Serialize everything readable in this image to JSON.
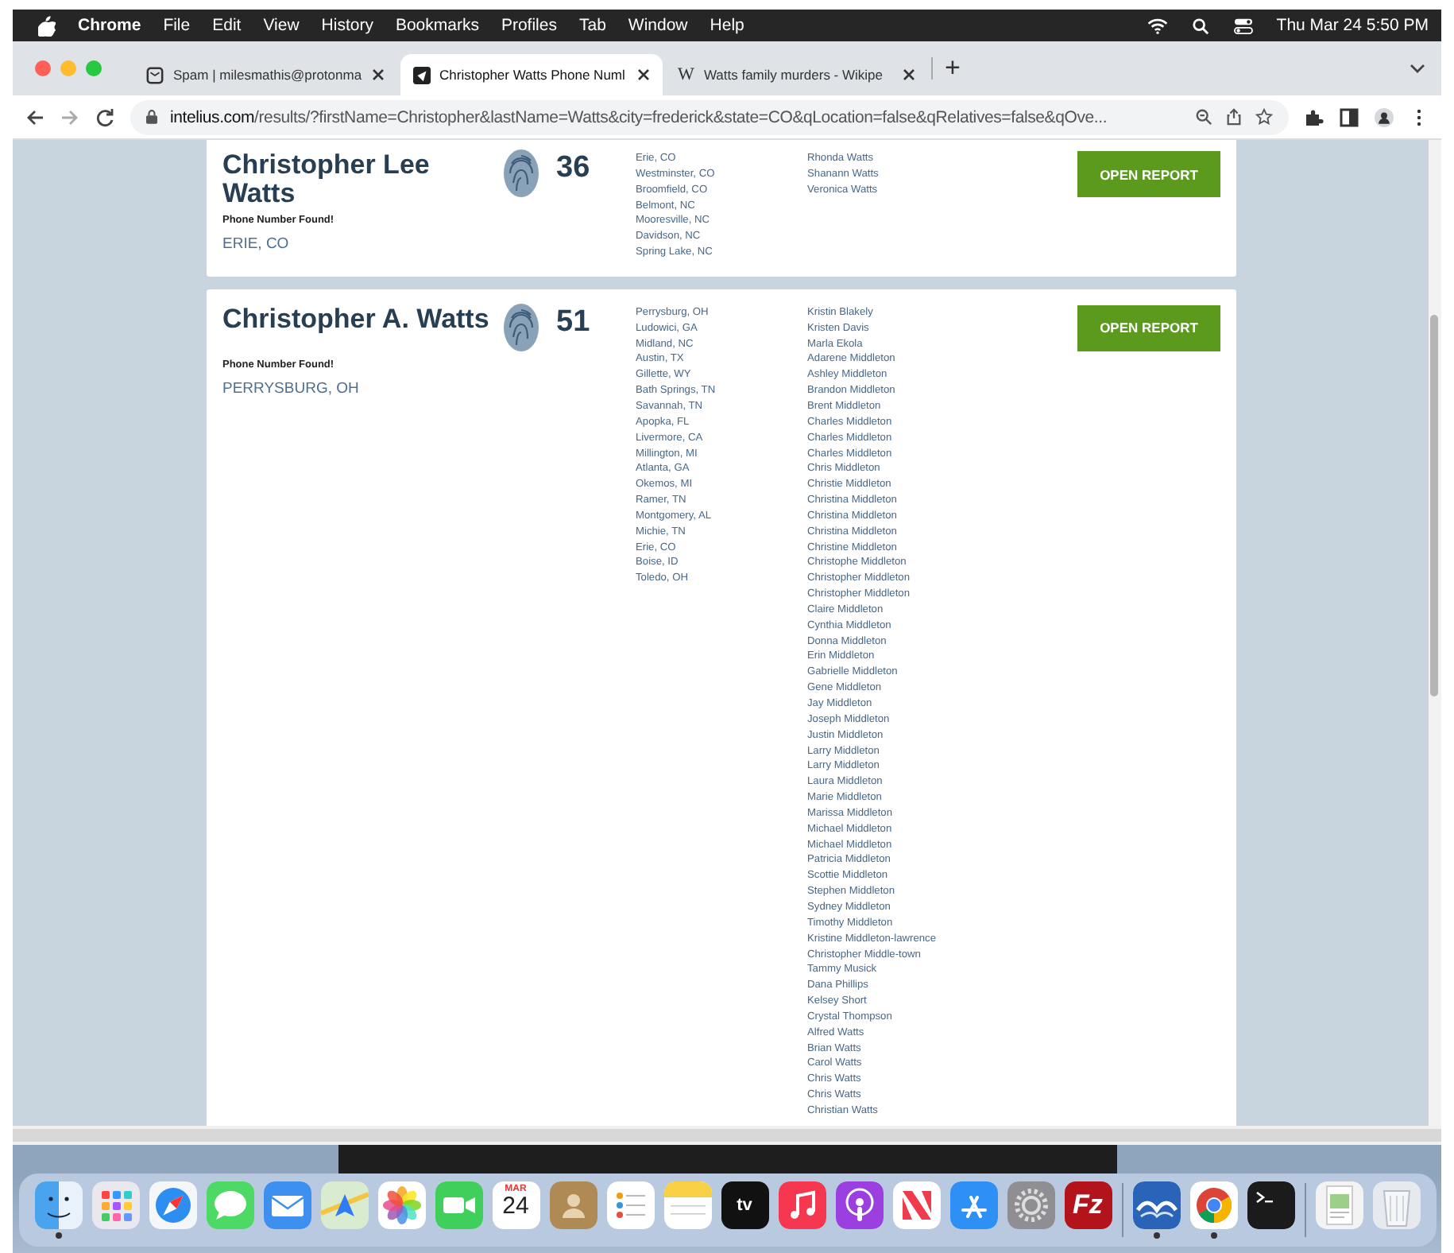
{
  "menu_bar": {
    "app": "Chrome",
    "menus": [
      "File",
      "Edit",
      "View",
      "History",
      "Bookmarks",
      "Profiles",
      "Tab",
      "Window",
      "Help"
    ],
    "clock": "Thu Mar 24  5:50 PM"
  },
  "tabs": [
    {
      "title": "Spam | milesmathis@protonma",
      "kind": "mail",
      "selected": false
    },
    {
      "title": "Christopher Watts Phone Numl",
      "kind": "site",
      "selected": true
    },
    {
      "title": "Watts family murders - Wikipe",
      "kind": "wiki",
      "selected": false
    }
  ],
  "wiki_glyph": "W",
  "new_tab": "+",
  "address_bar": {
    "host": "intelius.com",
    "path": "/results/?firstName=Christopher&lastName=Watts&city=frederick&state=CO&qLocation=false&qRelatives=false&qOve..."
  },
  "results": [
    {
      "name": "Christopher Lee Watts",
      "phone_note": "Phone Number Found!",
      "location": "ERIE, CO",
      "age": "36",
      "button": "OPEN REPORT",
      "cut_top": true,
      "locations": [
        "Erie, CO",
        "Westminster, CO",
        "Broomfield, CO",
        "Belmont, NC",
        "Mooresville, NC",
        "Davidson, NC",
        "Spring Lake, NC"
      ],
      "relatives": [
        "Rhonda Watts",
        "Shanann Watts",
        "Veronica Watts"
      ]
    },
    {
      "name": "Christopher A. Watts",
      "phone_note": "Phone Number Found!",
      "location": "PERRYSBURG, OH",
      "age": "51",
      "button": "OPEN REPORT",
      "cut_top": false,
      "locations": [
        "Perrysburg, OH",
        "Ludowici, GA",
        "Midland, NC",
        "Austin, TX",
        "Gillette, WY",
        "Bath Springs, TN",
        "Savannah, TN",
        "Apopka, FL",
        "Livermore, CA",
        "Millington, MI",
        "Atlanta, GA",
        "Okemos, MI",
        "Ramer, TN",
        "Montgomery, AL",
        "Michie, TN",
        "Erie, CO",
        "Boise, ID",
        "Toledo, OH"
      ],
      "relatives": [
        "Kristin Blakely",
        "Kristen Davis",
        "Marla Ekola",
        "Adarene Middleton",
        "Ashley Middleton",
        "Brandon Middleton",
        "Brent Middleton",
        "Charles Middleton",
        "Charles Middleton",
        "Charles Middleton",
        "Chris Middleton",
        "Christie Middleton",
        "Christina Middleton",
        "Christina Middleton",
        "Christina Middleton",
        "Christine Middleton",
        "Christophe Middleton",
        "Christopher Middleton",
        "Christopher Middleton",
        "Claire Middleton",
        "Cynthia Middleton",
        "Donna Middleton",
        "Erin Middleton",
        "Gabrielle Middleton",
        "Gene Middleton",
        "Jay Middleton",
        "Joseph Middleton",
        "Justin Middleton",
        "Larry Middleton",
        "Larry Middleton",
        "Laura Middleton",
        "Marie Middleton",
        "Marissa Middleton",
        "Michael Middleton",
        "Michael Middleton",
        "Patricia Middleton",
        "Scottie Middleton",
        "Stephen Middleton",
        "Sydney Middleton",
        "Timothy Middleton",
        "Kristine Middleton-lawrence",
        "Christopher Middle-town",
        "Tammy Musick",
        "Dana Phillips",
        "Kelsey Short",
        "Crystal Thompson",
        "Alfred Watts",
        "Brian Watts",
        "Carol Watts",
        "Chris Watts",
        "Chris Watts",
        "Christian Watts"
      ]
    }
  ],
  "dock": [
    {
      "kind": "finder",
      "running": true
    },
    {
      "kind": "launchpad",
      "running": false
    },
    {
      "kind": "safari",
      "running": false
    },
    {
      "kind": "messages",
      "running": false
    },
    {
      "kind": "mail",
      "running": false
    },
    {
      "kind": "maps",
      "running": false
    },
    {
      "kind": "photos",
      "running": false
    },
    {
      "kind": "facetime",
      "running": false
    },
    {
      "kind": "calendar",
      "running": false,
      "month": "MAR",
      "day": "24"
    },
    {
      "kind": "contacts",
      "running": false
    },
    {
      "kind": "reminders",
      "running": false
    },
    {
      "kind": "notes",
      "running": false
    },
    {
      "kind": "tv",
      "running": false,
      "label": "tv"
    },
    {
      "kind": "music",
      "running": false
    },
    {
      "kind": "podcasts",
      "running": false
    },
    {
      "kind": "news",
      "running": false
    },
    {
      "kind": "appstore",
      "running": false
    },
    {
      "kind": "settings",
      "running": false
    },
    {
      "kind": "filezilla",
      "running": false,
      "label": "Fz"
    },
    {
      "kind": "divider"
    },
    {
      "kind": "openoffice",
      "running": true
    },
    {
      "kind": "chrome",
      "running": true
    },
    {
      "kind": "terminal",
      "running": false
    },
    {
      "kind": "divider"
    },
    {
      "kind": "preview",
      "running": false
    },
    {
      "kind": "trash",
      "running": false
    }
  ]
}
